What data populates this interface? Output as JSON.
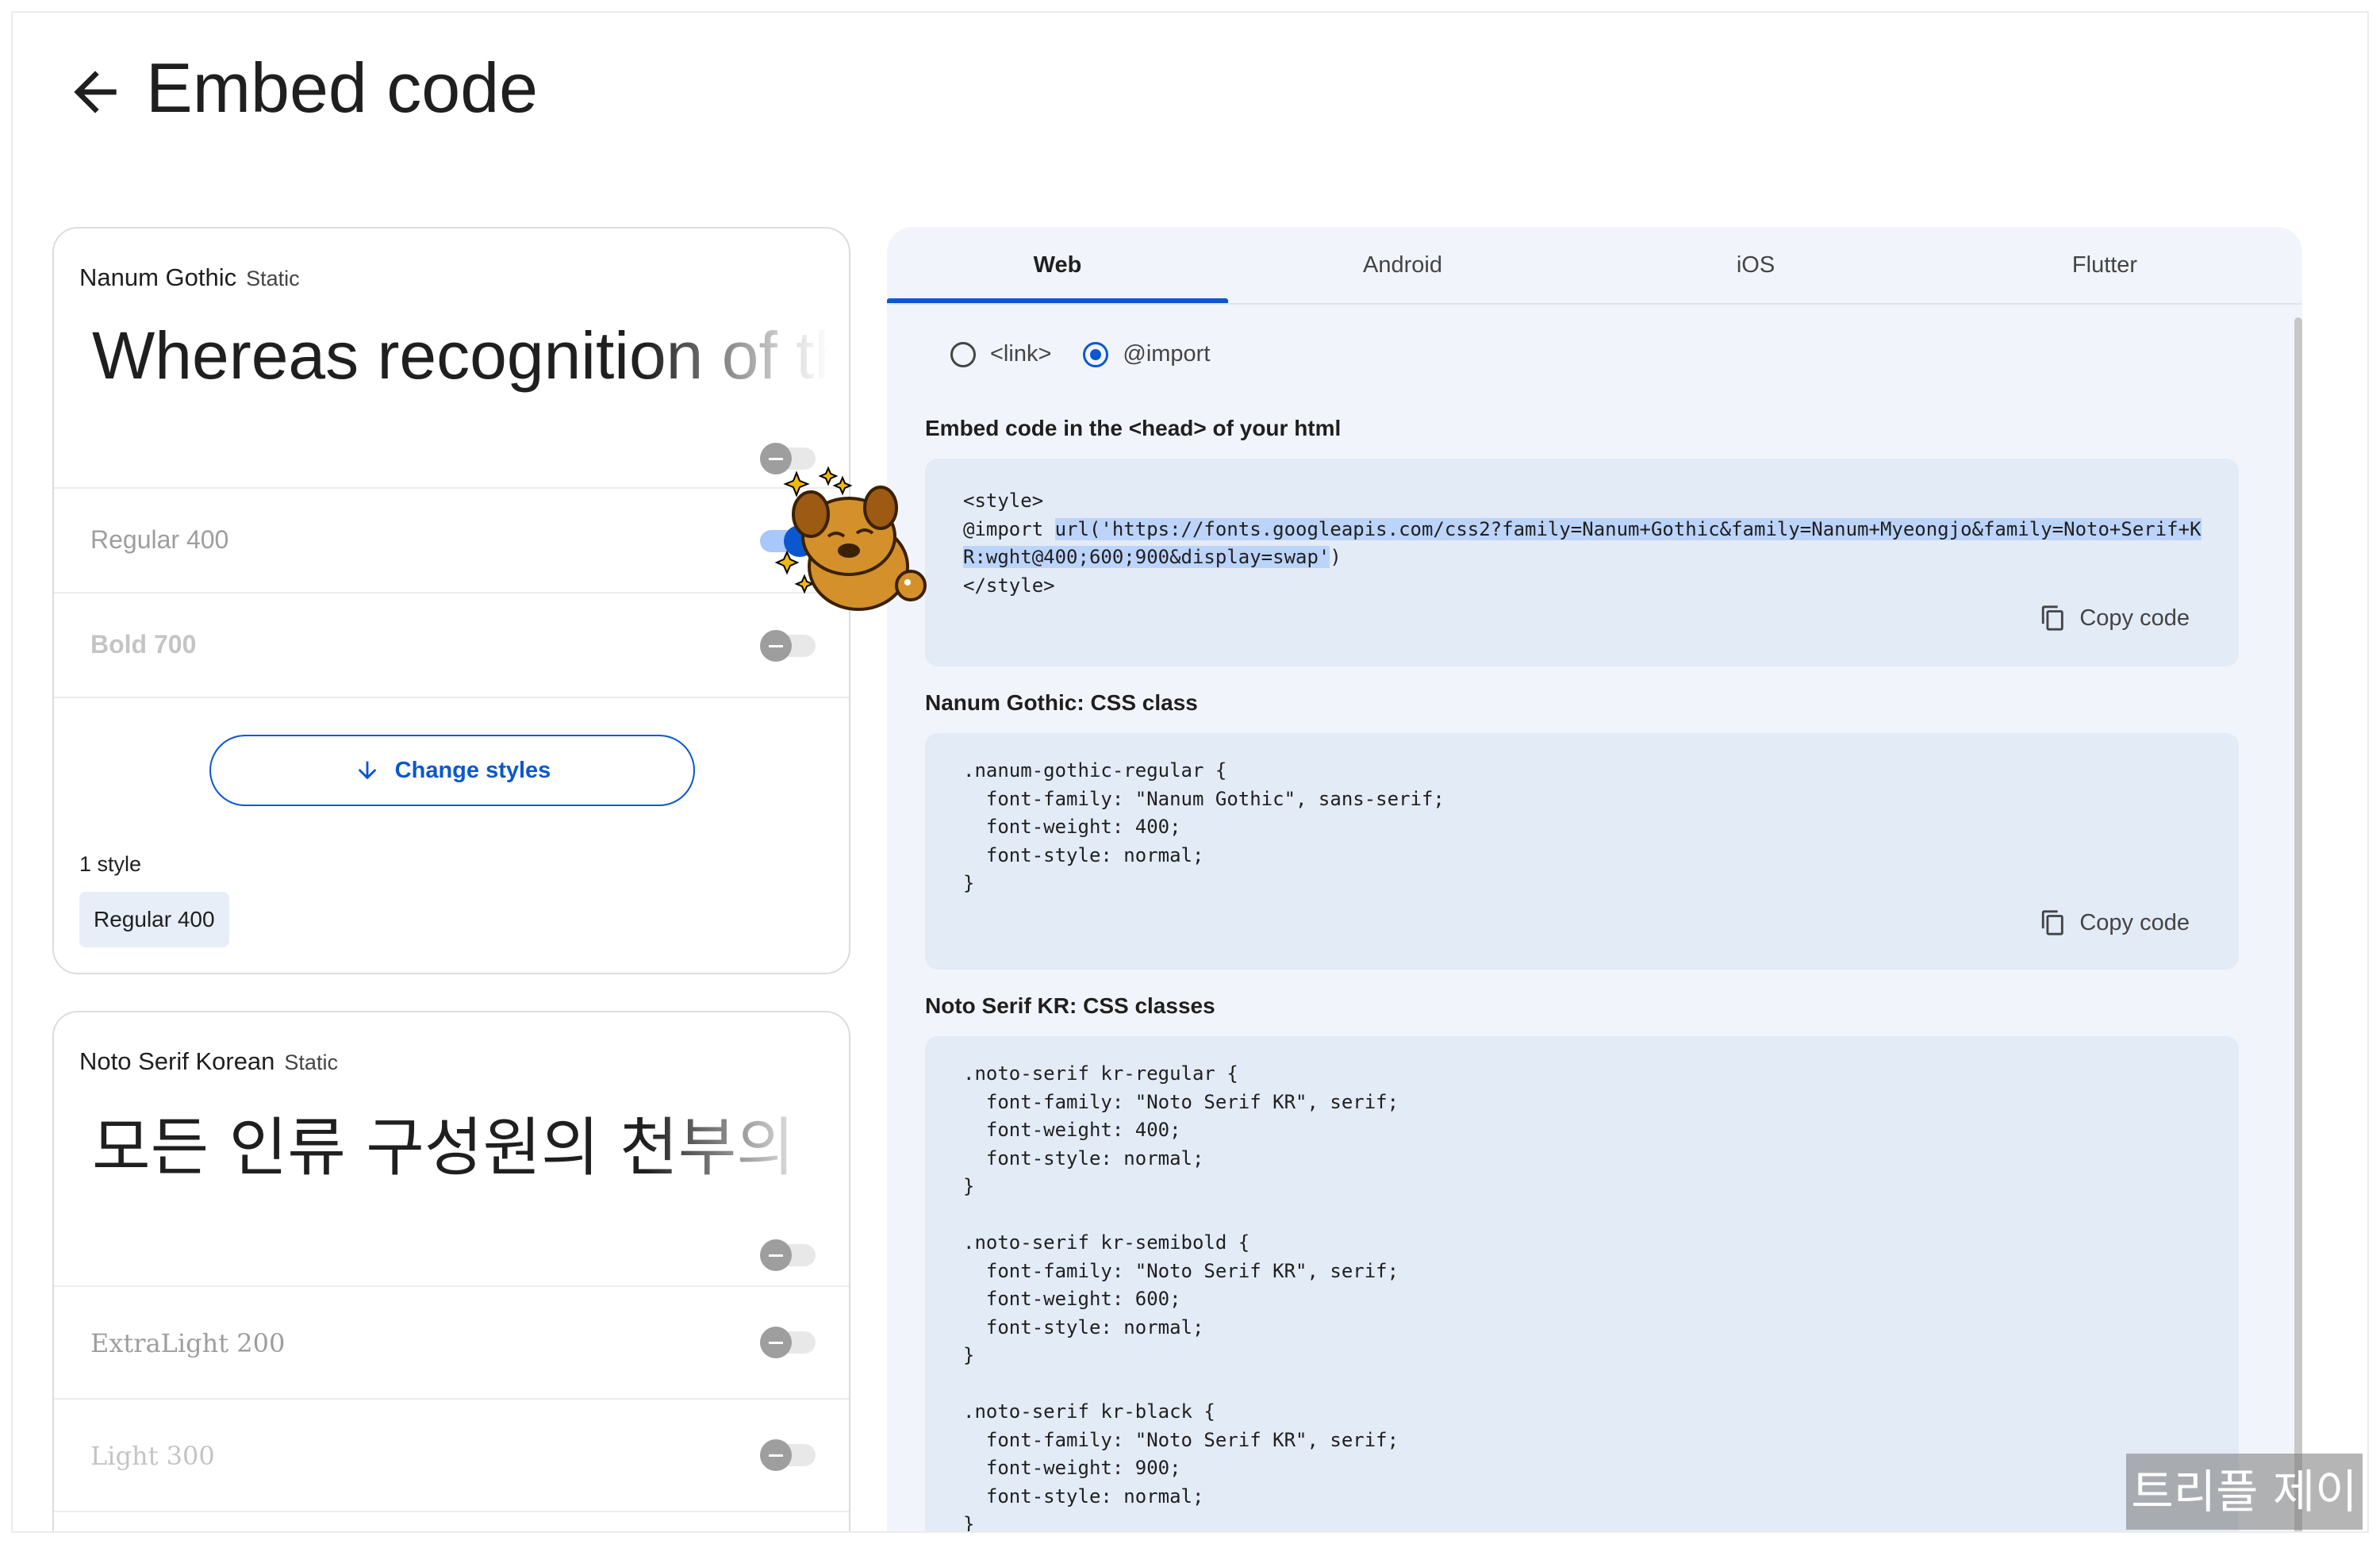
{
  "header": {
    "title": "Embed code"
  },
  "font_cards": [
    {
      "family": "Nanum Gothic",
      "kind": "Static",
      "preview": "Whereas recognition of the inherent dignity",
      "styles": [
        {
          "label": "Regular 400",
          "on": true
        },
        {
          "label": "Bold 700",
          "on": false
        }
      ],
      "change_styles_label": "Change styles",
      "style_count": "1 style",
      "selected_style": "Regular 400"
    },
    {
      "family": "Noto Serif Korean",
      "kind": "Static",
      "preview": "모든 인류 구성원의 천부의",
      "styles": [
        {
          "label": "ExtraLight 200",
          "on": false
        },
        {
          "label": "Light 300",
          "on": false
        }
      ]
    }
  ],
  "tabs": [
    {
      "label": "Web",
      "active": true
    },
    {
      "label": "Android",
      "active": false
    },
    {
      "label": "iOS",
      "active": false
    },
    {
      "label": "Flutter",
      "active": false
    }
  ],
  "embed_options": [
    {
      "label": "<link>",
      "checked": false
    },
    {
      "label": "@import",
      "checked": true
    }
  ],
  "sections": [
    {
      "title": "Embed code in the <head> of your html",
      "code_before": "<style>\n@import ",
      "code_highlight": "url('https://fonts.googleapis.com/css2?family=Nanum+Gothic&family=Nanum+Myeongjo&family=Noto+Serif+K\nR:wght@400;600;900&display=swap'",
      "code_after": ")\n</style>",
      "copy_label": "Copy code"
    },
    {
      "title": "Nanum Gothic: CSS class",
      "code": ".nanum-gothic-regular {\n  font-family: \"Nanum Gothic\", sans-serif;\n  font-weight: 400;\n  font-style: normal;\n}",
      "copy_label": "Copy code"
    },
    {
      "title": "Noto Serif KR: CSS classes",
      "code": ".noto-serif kr-regular {\n  font-family: \"Noto Serif KR\", serif;\n  font-weight: 400;\n  font-style: normal;\n}\n\n.noto-serif kr-semibold {\n  font-family: \"Noto Serif KR\", serif;\n  font-weight: 600;\n  font-style: normal;\n}\n\n.noto-serif kr-black {\n  font-family: \"Noto Serif KR\", serif;\n  font-weight: 900;\n  font-style: normal;\n}"
    }
  ],
  "watermark": "트리플 제이",
  "colors": {
    "accent": "#0b57d0",
    "panel_bg": "#f1f5fb",
    "code_bg": "#e3ebf7",
    "highlight": "#bcd4f9"
  }
}
